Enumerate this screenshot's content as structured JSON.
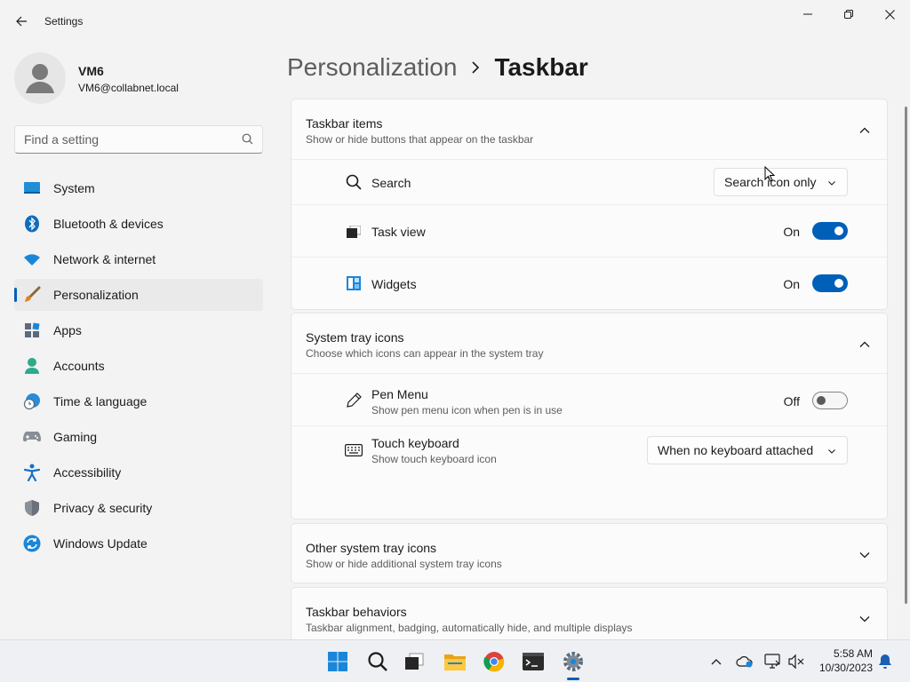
{
  "window": {
    "title": "Settings",
    "controls": [
      "minimize",
      "restore",
      "close"
    ]
  },
  "profile": {
    "name": "VM6",
    "email": "VM6@collabnet.local"
  },
  "search": {
    "placeholder": "Find a setting"
  },
  "sidebar": {
    "items": [
      {
        "label": "System",
        "icon": "system-icon"
      },
      {
        "label": "Bluetooth & devices",
        "icon": "bluetooth-icon"
      },
      {
        "label": "Network & internet",
        "icon": "wifi-icon"
      },
      {
        "label": "Personalization",
        "icon": "brush-icon",
        "active": true
      },
      {
        "label": "Apps",
        "icon": "apps-icon"
      },
      {
        "label": "Accounts",
        "icon": "accounts-icon"
      },
      {
        "label": "Time & language",
        "icon": "globe-clock-icon"
      },
      {
        "label": "Gaming",
        "icon": "gamepad-icon"
      },
      {
        "label": "Accessibility",
        "icon": "accessibility-icon"
      },
      {
        "label": "Privacy & security",
        "icon": "shield-icon"
      },
      {
        "label": "Windows Update",
        "icon": "update-icon"
      }
    ]
  },
  "breadcrumb": {
    "parent": "Personalization",
    "current": "Taskbar"
  },
  "sections": {
    "taskbar_items": {
      "title": "Taskbar items",
      "subtitle": "Show or hide buttons that appear on the taskbar",
      "rows": {
        "search": {
          "label": "Search",
          "value": "Search icon only"
        },
        "task_view": {
          "label": "Task view",
          "state": "On"
        },
        "widgets": {
          "label": "Widgets",
          "state": "On"
        }
      }
    },
    "system_tray_icons": {
      "title": "System tray icons",
      "subtitle": "Choose which icons can appear in the system tray",
      "rows": {
        "pen_menu": {
          "label": "Pen Menu",
          "sub": "Show pen menu icon when pen is in use",
          "state": "Off"
        },
        "touch_keyboard": {
          "label": "Touch keyboard",
          "sub": "Show touch keyboard icon",
          "value": "When no keyboard attached"
        }
      }
    },
    "other_tray_icons": {
      "title": "Other system tray icons",
      "subtitle": "Show or hide additional system tray icons"
    },
    "taskbar_behaviors": {
      "title": "Taskbar behaviors",
      "subtitle": "Taskbar alignment, badging, automatically hide, and multiple displays"
    }
  },
  "taskbar": {
    "apps": [
      "start-icon",
      "search-icon",
      "task-view-icon",
      "file-explorer-icon",
      "chrome-icon",
      "terminal-icon",
      "settings-icon"
    ],
    "clock": {
      "time": "5:58 AM",
      "date": "10/30/2023"
    }
  },
  "colors": {
    "accent": "#005fb8",
    "background": "#f3f3f3",
    "card": "#fbfbfb"
  }
}
